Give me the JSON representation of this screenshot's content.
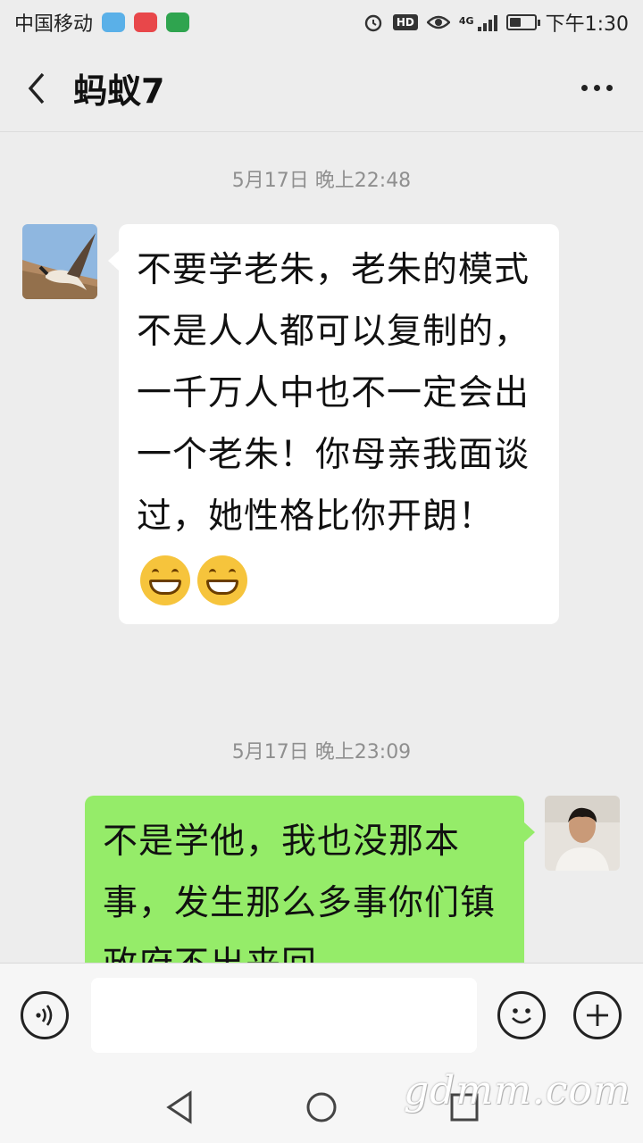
{
  "status_bar": {
    "carrier": "中国移动",
    "network": "4G",
    "time": "下午1:30",
    "battery_level": 0.45,
    "icons": [
      "app-notification-icon",
      "app-notification-icon",
      "app-notification-icon",
      "alarm-icon",
      "hd-icon",
      "eye-icon",
      "signal-icon",
      "battery-icon"
    ]
  },
  "header": {
    "title": "蚂蚁7"
  },
  "messages": [
    {
      "time": "5月17日 晚上22:48",
      "direction": "incoming",
      "text": "不要学老朱，老朱的模式不是人人都可以复制的，一千万人中也不一定会出一个老朱！你母亲我面谈过，她性格比你开朗！",
      "emojis": [
        "grin-emoji",
        "grin-emoji"
      ]
    },
    {
      "time": "5月17日 晚上23:09",
      "direction": "outgoing",
      "text": "不是学他，我也没那本事，发生那么多事你们镇政府不出来回"
    }
  ],
  "input": {
    "value": ""
  },
  "watermark": "gdmm.com",
  "colors": {
    "background": "#ededed",
    "incoming_bubble": "#ffffff",
    "outgoing_bubble": "#95ec69"
  }
}
